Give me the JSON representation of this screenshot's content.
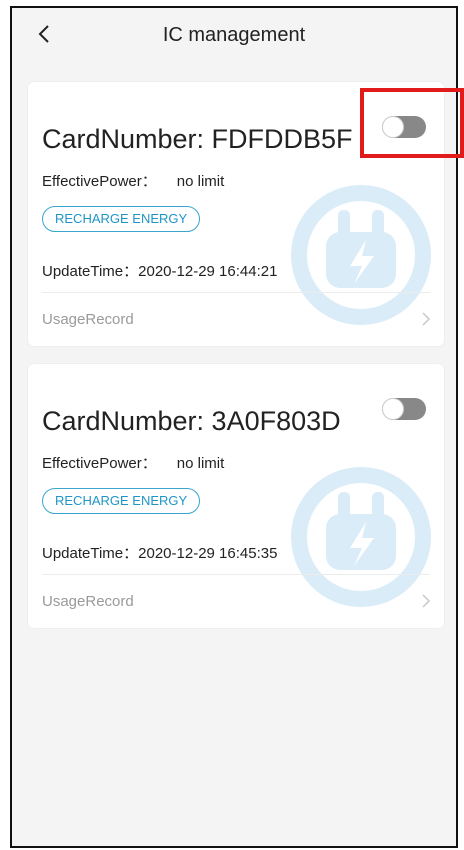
{
  "header": {
    "title": "IC management"
  },
  "cards": [
    {
      "card_number": "CardNumber: FDFDDB5F",
      "power_label": "EffectivePower：",
      "power_value": "no limit",
      "recharge_label": "RECHARGE ENERGY",
      "update_text": "UpdateTime：2020-12-29 16:44:21",
      "usage_label": "UsageRecord",
      "enabled": false
    },
    {
      "card_number": "CardNumber: 3A0F803D",
      "power_label": "EffectivePower：",
      "power_value": "no limit",
      "recharge_label": "RECHARGE ENERGY",
      "update_text": "UpdateTime：2020-12-29 16:45:35",
      "usage_label": "UsageRecord",
      "enabled": false
    }
  ],
  "icons": {
    "back": "chevron-left-icon",
    "usage_arrow": "chevron-right-icon",
    "watermark": "charging-plug-icon"
  },
  "colors": {
    "accent": "#1f95c6",
    "highlight": "#e11a1a",
    "toggle_off": "#888888"
  }
}
